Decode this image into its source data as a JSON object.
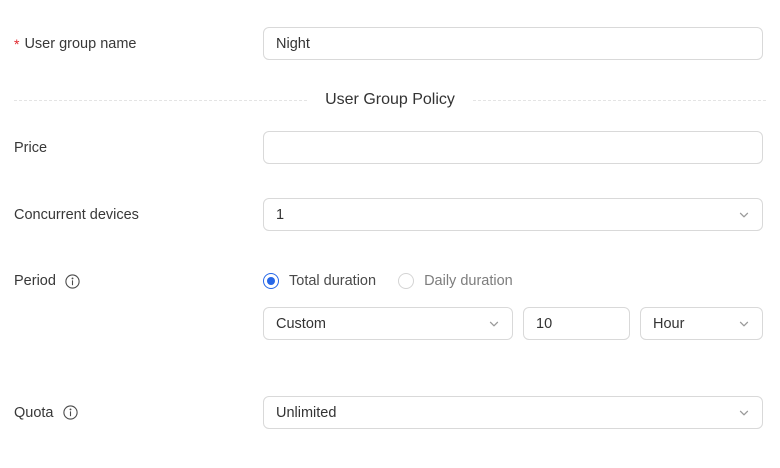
{
  "form": {
    "user_group_name": {
      "required_marker": "*",
      "label": "User group name",
      "value": "Night"
    },
    "section_divider": {
      "title": "User Group Policy"
    },
    "price": {
      "label": "Price",
      "value": ""
    },
    "concurrent_devices": {
      "label": "Concurrent devices",
      "value": "1"
    },
    "period": {
      "label": "Period",
      "options": [
        {
          "label": "Total duration",
          "selected": true
        },
        {
          "label": "Daily duration",
          "selected": false
        }
      ],
      "mode_value": "Custom",
      "duration_value": "10",
      "unit_value": "Hour"
    },
    "quota": {
      "label": "Quota",
      "value": "Unlimited"
    }
  },
  "icons": {
    "chevron": "chevron-down-icon",
    "info": "info-circle-icon"
  },
  "colors": {
    "accent_blue": "#2667e8",
    "required_red": "#e0282e",
    "border_gray": "#d9d9d9",
    "divider_dash": "#e4e4e4"
  }
}
